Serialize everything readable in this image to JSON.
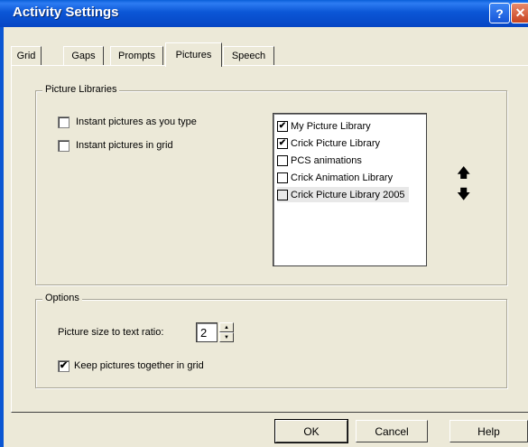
{
  "window": {
    "title": "Activity Settings",
    "help_glyph": "?",
    "close_glyph": "✕"
  },
  "tabs": [
    {
      "label": "Grid"
    },
    {
      "label": "Gaps"
    },
    {
      "label": "Prompts"
    },
    {
      "label": "Pictures",
      "active": true
    },
    {
      "label": "Speech"
    }
  ],
  "picture_libraries": {
    "legend": "Picture Libraries",
    "options": [
      {
        "label": "Instant pictures as you type",
        "checked": false
      },
      {
        "label": "Instant pictures in grid",
        "checked": false
      }
    ],
    "libraries": [
      {
        "label": "My Picture Library",
        "checked": true
      },
      {
        "label": "Crick Picture Library",
        "checked": true
      },
      {
        "label": "PCS animations",
        "checked": false
      },
      {
        "label": "Crick Animation Library",
        "checked": false
      },
      {
        "label": "Crick Picture Library 2005",
        "checked": false,
        "selected": true
      }
    ],
    "move_up_glyph": "🡅",
    "move_down_glyph": "🡇"
  },
  "options_group": {
    "legend": "Options",
    "ratio_label": "Picture size to text ratio:",
    "ratio_value": "2",
    "keep_together_label": "Keep pictures together in grid",
    "keep_together_checked": true
  },
  "buttons": {
    "ok": "OK",
    "cancel": "Cancel",
    "help": "Help"
  },
  "check_glyph": "✔"
}
